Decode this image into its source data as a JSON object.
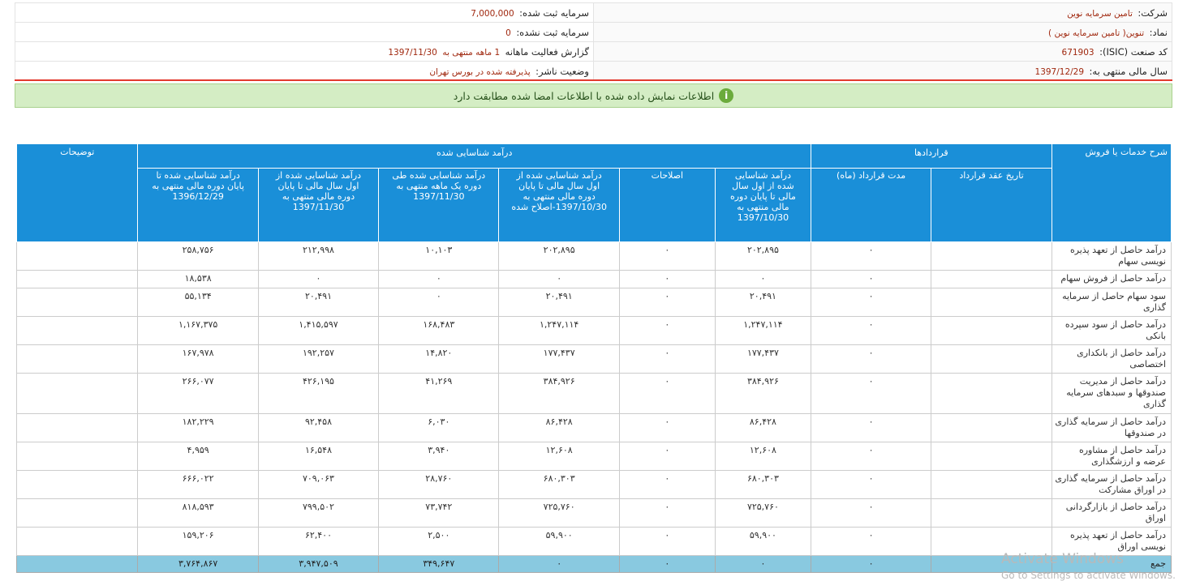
{
  "info": {
    "company_label": "شرکت:",
    "company_value": "تامین سرمایه نوین",
    "capital_registered_label": "سرمایه ثبت شده:",
    "capital_registered_value": "7,000,000",
    "symbol_label": "نماد:",
    "symbol_value": "تنوین( تامین سرمایه نوین )",
    "capital_unregistered_label": "سرمایه ثبت نشده:",
    "capital_unregistered_value": "0",
    "isic_label": "کد صنعت (ISIC):",
    "isic_value": "671903",
    "report_label": "گزارش فعالیت ماهانه",
    "report_value": "1 ماهه منتهی به",
    "report_date": "1397/11/30",
    "fiscal_label": "سال مالی منتهی به:",
    "fiscal_value": "1397/12/29",
    "status_label": "وضعیت ناشر:",
    "status_value": "پذیرفته شده در بورس تهران"
  },
  "banner": {
    "icon": "i",
    "text": "اطلاعات نمایش داده شده با اطلاعات امضا شده مطابقت دارد"
  },
  "table": {
    "groups": {
      "description": "شرح خدمات یا فروش",
      "contracts": "قراردادها",
      "revenue": "درآمد شناسایی شده",
      "notes": "توضیحات"
    },
    "sub": {
      "contract_date": "تاریخ عقد قرارداد",
      "contract_duration": "مدت قرارداد (ماه)",
      "rev_to_1397_10_30": "درآمد شناسایی شده از اول سال مالی تا پایان دوره مالی منتهی به 1397/10/30",
      "corrections": "اصلاحات",
      "rev_corrected": "درآمد شناسایی شده از اول سال مالی تا پایان دوره مالی منتهی به 1397/10/30-اصلاح شده",
      "rev_one_month": "درآمد شناسایی شده طی دوره یک ماهه منتهی به 1397/11/30",
      "rev_to_1397_11_30": "درآمد شناسایی شده از اول سال مالی تا پایان دوره مالی منتهی به 1397/11/30",
      "rev_prev_year": "درآمد شناسایی شده تا پایان دوره مالی منتهی به 1396/12/29"
    },
    "rows": [
      {
        "desc": "درآمد حاصل از تعهد پذیره نویسی سهام",
        "date": "",
        "duration": "۰",
        "c1": "۲۰۲,۸۹۵",
        "c2": "۰",
        "c3": "۲۰۲,۸۹۵",
        "c4": "۱۰,۱۰۳",
        "c5": "۲۱۲,۹۹۸",
        "c6": "۲۵۸,۷۵۶",
        "notes": ""
      },
      {
        "desc": "درآمد حاصل از فروش سهام",
        "date": "",
        "duration": "۰",
        "c1": "۰",
        "c2": "۰",
        "c3": "۰",
        "c4": "۰",
        "c5": "۰",
        "c6": "۱۸,۵۳۸",
        "notes": ""
      },
      {
        "desc": "سود سهام حاصل از سرمایه گذاری",
        "date": "",
        "duration": "۰",
        "c1": "۲۰,۴۹۱",
        "c2": "۰",
        "c3": "۲۰,۴۹۱",
        "c4": "۰",
        "c5": "۲۰,۴۹۱",
        "c6": "۵۵,۱۳۴",
        "notes": ""
      },
      {
        "desc": "درآمد حاصل از سود سپرده بانکی",
        "date": "",
        "duration": "۰",
        "c1": "۱,۲۴۷,۱۱۴",
        "c2": "۰",
        "c3": "۱,۲۴۷,۱۱۴",
        "c4": "۱۶۸,۴۸۳",
        "c5": "۱,۴۱۵,۵۹۷",
        "c6": "۱,۱۶۷,۳۷۵",
        "notes": ""
      },
      {
        "desc": "درآمد حاصل از بانکداری اختصاصی",
        "date": "",
        "duration": "۰",
        "c1": "۱۷۷,۴۳۷",
        "c2": "۰",
        "c3": "۱۷۷,۴۳۷",
        "c4": "۱۴,۸۲۰",
        "c5": "۱۹۲,۲۵۷",
        "c6": "۱۶۷,۹۷۸",
        "notes": ""
      },
      {
        "desc": "درآمد حاصل از مدیریت صندوقها و سبدهای سرمایه گذاری",
        "date": "",
        "duration": "۰",
        "c1": "۳۸۴,۹۲۶",
        "c2": "۰",
        "c3": "۳۸۴,۹۲۶",
        "c4": "۴۱,۲۶۹",
        "c5": "۴۲۶,۱۹۵",
        "c6": "۲۶۶,۰۷۷",
        "notes": ""
      },
      {
        "desc": "درآمد حاصل از سرمایه گذاری در صندوقها",
        "date": "",
        "duration": "۰",
        "c1": "۸۶,۴۲۸",
        "c2": "۰",
        "c3": "۸۶,۴۲۸",
        "c4": "۶,۰۳۰",
        "c5": "۹۲,۴۵۸",
        "c6": "۱۸۲,۲۲۹",
        "notes": ""
      },
      {
        "desc": "درآمد حاصل از مشاوره عرضه و ارزشگذاری",
        "date": "",
        "duration": "۰",
        "c1": "۱۲,۶۰۸",
        "c2": "۰",
        "c3": "۱۲,۶۰۸",
        "c4": "۳,۹۴۰",
        "c5": "۱۶,۵۴۸",
        "c6": "۴,۹۵۹",
        "notes": ""
      },
      {
        "desc": "درآمد حاصل از سرمایه گذاری در اوراق مشارکت",
        "date": "",
        "duration": "۰",
        "c1": "۶۸۰,۳۰۳",
        "c2": "۰",
        "c3": "۶۸۰,۳۰۳",
        "c4": "۲۸,۷۶۰",
        "c5": "۷۰۹,۰۶۳",
        "c6": "۶۶۶,۰۲۲",
        "notes": ""
      },
      {
        "desc": "درآمد حاصل از بازارگردانی اوراق",
        "date": "",
        "duration": "۰",
        "c1": "۷۲۵,۷۶۰",
        "c2": "۰",
        "c3": "۷۲۵,۷۶۰",
        "c4": "۷۳,۷۴۲",
        "c5": "۷۹۹,۵۰۲",
        "c6": "۸۱۸,۵۹۳",
        "notes": ""
      },
      {
        "desc": "درآمد حاصل از تعهد پذیره نویسی اوراق",
        "date": "",
        "duration": "۰",
        "c1": "۵۹,۹۰۰",
        "c2": "۰",
        "c3": "۵۹,۹۰۰",
        "c4": "۲,۵۰۰",
        "c5": "۶۲,۴۰۰",
        "c6": "۱۵۹,۲۰۶",
        "notes": ""
      }
    ],
    "total": {
      "desc": "جمع",
      "date": "",
      "duration": "۰",
      "c1": "۰",
      "c2": "۰",
      "c3": "۰",
      "c4": "۳۴۹,۶۴۷",
      "c5": "۳,۹۴۷,۵۰۹",
      "c6": "۳,۷۶۴,۸۶۷",
      "notes": ""
    }
  },
  "watermark": {
    "line1": "Activate Windows",
    "line2": "Go to Settings to activate Windows."
  }
}
